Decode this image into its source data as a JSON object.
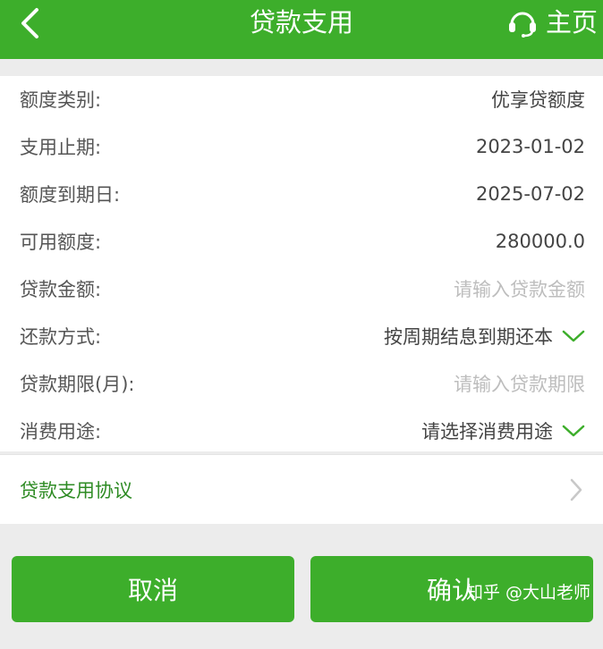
{
  "header": {
    "title": "贷款支用",
    "home_label": "主页"
  },
  "form": {
    "rows": [
      {
        "label": "额度类别:",
        "value": "优享贷额度"
      },
      {
        "label": "支用止期:",
        "value": "2023-01-02"
      },
      {
        "label": "额度到期日:",
        "value": "2025-07-02"
      },
      {
        "label": "可用额度:",
        "value": "280000.0"
      },
      {
        "label": "贷款金额:",
        "placeholder": "请输入贷款金额"
      },
      {
        "label": "还款方式:",
        "value": "按周期结息到期还本"
      },
      {
        "label": "贷款期限(月):",
        "placeholder": "请输入贷款期限"
      },
      {
        "label": "消费用途:",
        "value": "请选择消费用途"
      }
    ]
  },
  "agreement": {
    "label": "贷款支用协议"
  },
  "actions": {
    "cancel_label": "取消",
    "confirm_label": "确认"
  },
  "watermark": "知乎 @大山老师",
  "colors": {
    "accent": "#3dae2b",
    "agreement_text": "#2e8b24",
    "placeholder": "#bdbdbd"
  },
  "icons": [
    "back-arrow-icon",
    "headset-icon",
    "chevron-down-icon",
    "chevron-right-icon"
  ]
}
